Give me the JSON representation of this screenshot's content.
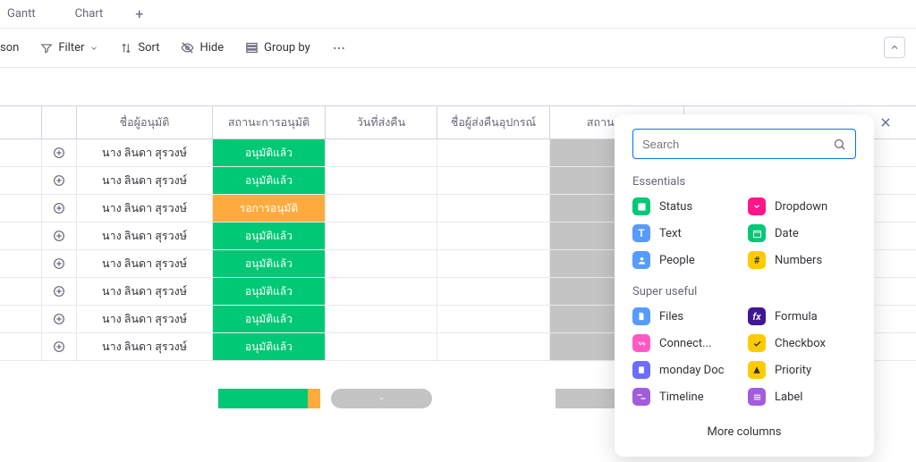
{
  "tabs": {
    "gantt": "Gantt",
    "chart": "Chart"
  },
  "toolbar": {
    "person": "son",
    "filter": "Filter",
    "sort": "Sort",
    "hide": "Hide",
    "group": "Group by"
  },
  "table": {
    "headers": {
      "approver": "ชื่อผู้อนุมัติ",
      "status": "สถานะการอนุมัติ",
      "return_date": "วันที่ส่งคืน",
      "returner": "ชื่อผู้ส่งคืนอุปกรณ์",
      "return_status": "สถานะการคื"
    },
    "approver_name": "นาง ลินดา สุรวงษ์",
    "status_approved": "อนุมัติแล้ว",
    "status_pending": "รอการอนุมัติ",
    "rows": [
      {
        "status": "approved"
      },
      {
        "status": "approved"
      },
      {
        "status": "pending"
      },
      {
        "status": "approved"
      },
      {
        "status": "approved"
      },
      {
        "status": "approved"
      },
      {
        "status": "approved"
      },
      {
        "status": "approved"
      }
    ],
    "summary_dash": "-"
  },
  "popover": {
    "search_placeholder": "Search",
    "sections": {
      "essentials": "Essentials",
      "super_useful": "Super useful"
    },
    "options": {
      "status": "Status",
      "dropdown": "Dropdown",
      "text": "Text",
      "date": "Date",
      "people": "People",
      "numbers": "Numbers",
      "files": "Files",
      "formula": "Formula",
      "connect": "Connect...",
      "checkbox": "Checkbox",
      "monday_doc": "monday Doc",
      "priority": "Priority",
      "timeline": "Timeline",
      "label": "Label"
    },
    "more": "More columns"
  },
  "colors": {
    "green": "#00c875",
    "orange": "#fdab3d",
    "blue": "#579bfc",
    "pink": "#ff5ac4",
    "violet": "#a25ddc",
    "darkblue": "#401694",
    "dpurple": "#7e3b8a",
    "yellow": "#ffcb00",
    "red": "#e2445c"
  }
}
